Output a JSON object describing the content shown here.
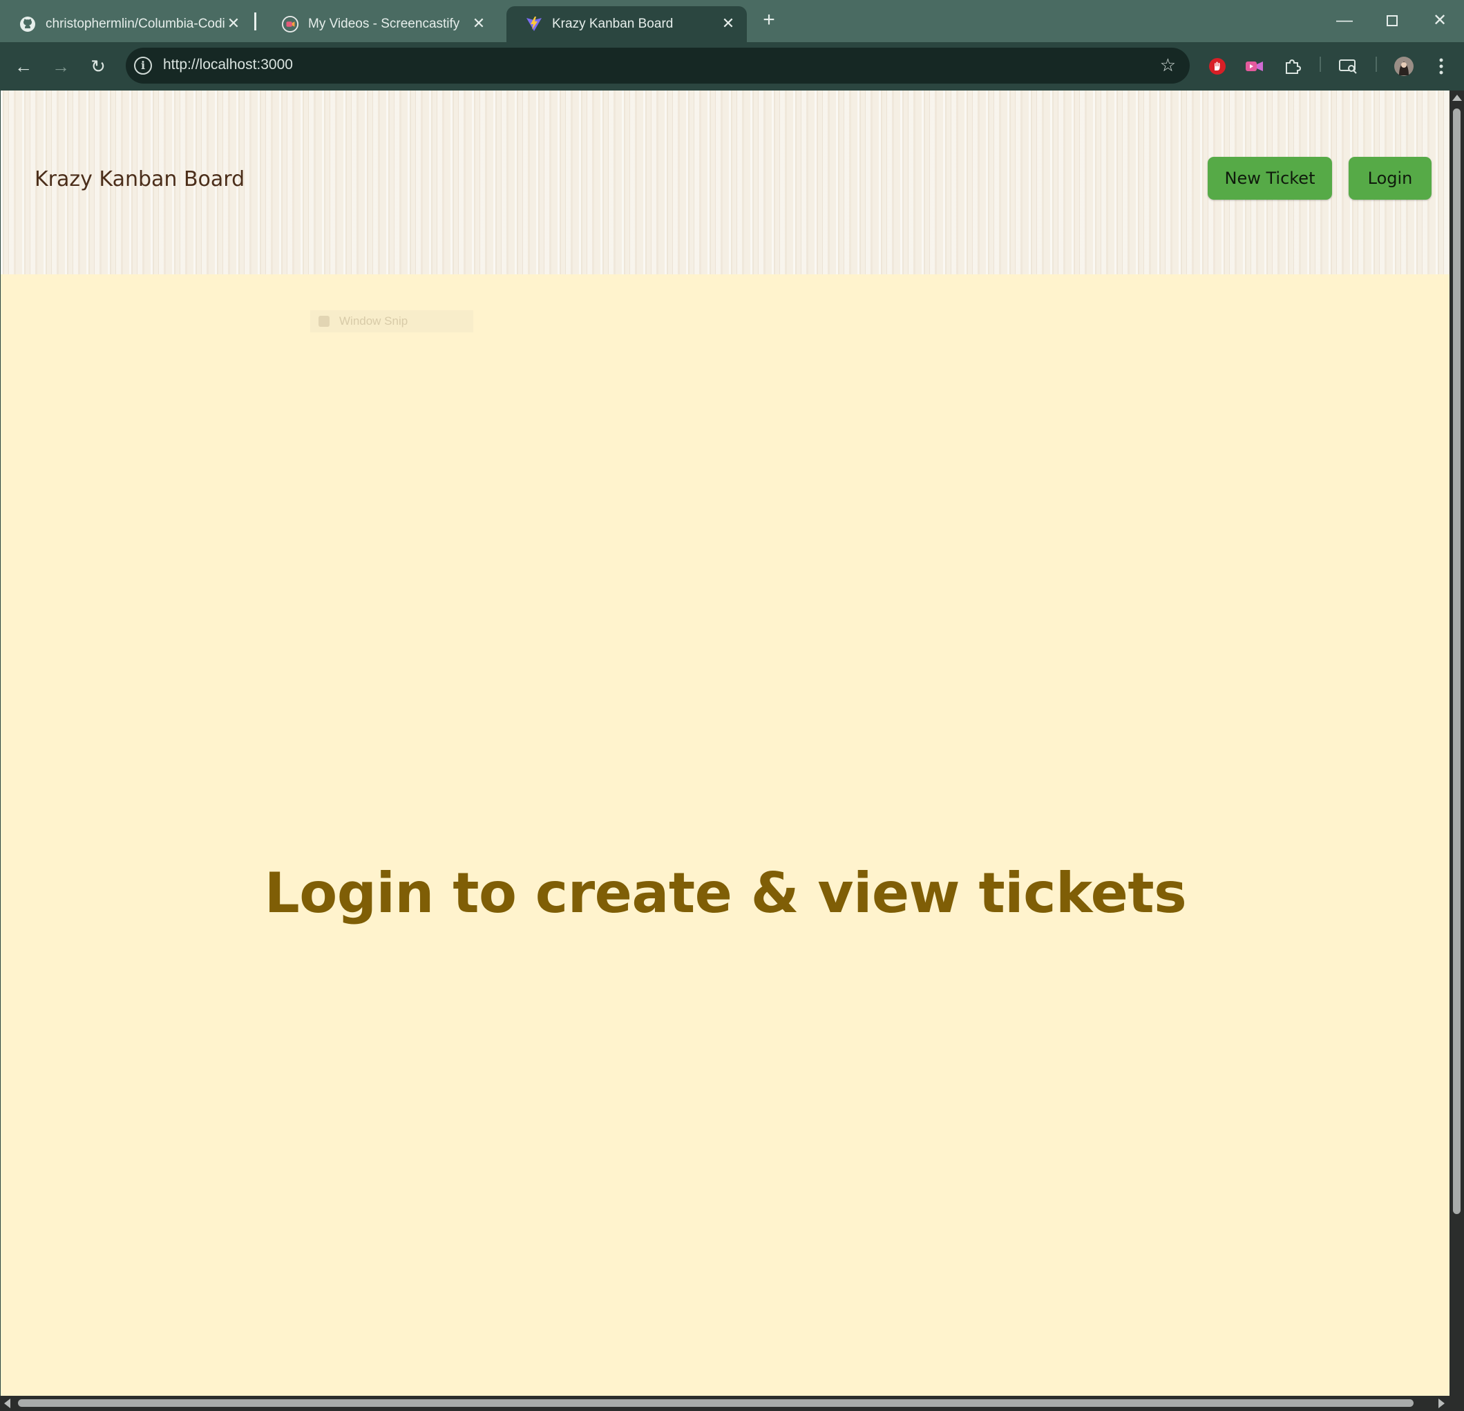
{
  "browser": {
    "tabs": [
      {
        "title": "christophermlin/Columbia-Codi",
        "icon": "github-icon"
      },
      {
        "title": "My Videos - Screencastify",
        "icon": "screencastify-icon"
      },
      {
        "title": "Krazy Kanban Board",
        "icon": "vite-icon",
        "active": true
      }
    ],
    "address": "http://localhost:3000"
  },
  "page": {
    "brand": "Krazy Kanban Board",
    "new_ticket_label": "New Ticket",
    "login_label": "Login",
    "hero_message": "Login to create & view tickets",
    "ghost_overlay": "Window Snip"
  },
  "colors": {
    "accent_button": "#56aa47",
    "page_background": "#fff3cd",
    "hero_text": "#7f5e06",
    "brand_text": "#4b2e1a"
  }
}
